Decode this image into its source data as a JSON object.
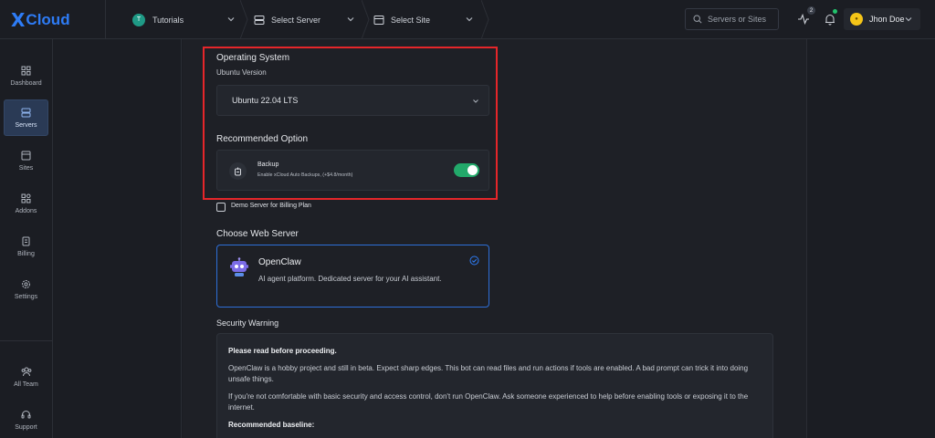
{
  "brand": {
    "name": "Cloud"
  },
  "header": {
    "breadcrumbs": [
      {
        "label": "Tutorials",
        "avatar_letter": "T"
      },
      {
        "label": "Select Server"
      },
      {
        "label": "Select Site"
      }
    ],
    "search_placeholder": "Servers or Sites",
    "activity_count": "2",
    "user": {
      "name": "Jhon Doe"
    }
  },
  "sidebar": {
    "items": [
      {
        "label": "Dashboard",
        "icon": "grid-icon"
      },
      {
        "label": "Servers",
        "icon": "server-icon",
        "active": true
      },
      {
        "label": "Sites",
        "icon": "browser-icon"
      },
      {
        "label": "Addons",
        "icon": "addons-icon"
      },
      {
        "label": "Billing",
        "icon": "billing-icon"
      },
      {
        "label": "Settings",
        "icon": "gear-icon"
      }
    ],
    "bottom": [
      {
        "label": "All Team",
        "icon": "team-icon"
      },
      {
        "label": "Support",
        "icon": "headset-icon"
      }
    ]
  },
  "os": {
    "heading": "Operating System",
    "version_label": "Ubuntu Version",
    "selected": "Ubuntu 22.04 LTS"
  },
  "recommended": {
    "heading": "Recommended Option",
    "backup_title": "Backup",
    "backup_desc": "Enable xCloud Auto Backups, (+$4.8/month)",
    "enabled": true
  },
  "demo_server_label": "Demo Server for Billing Plan",
  "web_server": {
    "heading": "Choose Web Server",
    "option_title": "OpenClaw",
    "option_desc": "AI agent platform. Dedicated server for your AI assistant."
  },
  "security": {
    "heading": "Security Warning",
    "title": "Please read before proceeding.",
    "p1": "OpenClaw is a hobby project and still in beta. Expect sharp edges. This bot can read files and run actions if tools are enabled. A bad prompt can trick it into doing unsafe things.",
    "p2": "If you're not comfortable with basic security and access control, don't run OpenClaw. Ask someone experienced to help before enabling tools or exposing it to the internet.",
    "p3": "Recommended baseline:"
  },
  "colors": {
    "accent": "#2e7cf6",
    "highlight": "#e6262a",
    "toggle_on": "#22a96a"
  }
}
